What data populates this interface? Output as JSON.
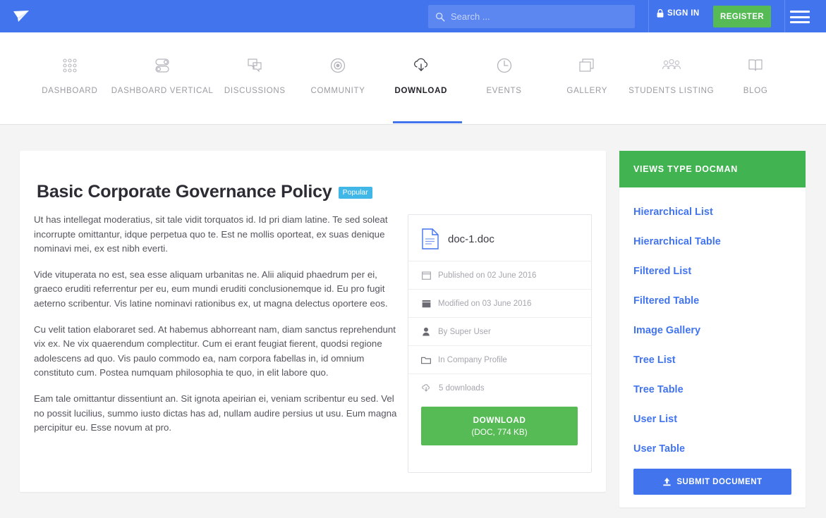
{
  "topbar": {
    "logo_icon": "paper-plane-icon",
    "search": {
      "placeholder": "Search ...",
      "value": "",
      "icon": "search-icon"
    },
    "signin_label": "SIGN IN",
    "signin_icon": "lock-icon",
    "register_label": "REGISTER",
    "menu_icon": "hamburger-menu-icon",
    "bg_color": "#4274ee",
    "register_color": "#56bb55"
  },
  "nav": {
    "items": [
      {
        "label": "DASHBOARD",
        "icon": "grid-dots-icon",
        "active": false
      },
      {
        "label": "DASHBOARD VERTICAL",
        "icon": "toggle-switches-icon",
        "active": false
      },
      {
        "label": "DISCUSSIONS",
        "icon": "chat-bubbles-icon",
        "active": false
      },
      {
        "label": "COMMUNITY",
        "icon": "circle-target-icon",
        "active": false
      },
      {
        "label": "DOWNLOAD",
        "icon": "cloud-download-icon",
        "active": true
      },
      {
        "label": "EVENTS",
        "icon": "clock-icon",
        "active": false
      },
      {
        "label": "GALLERY",
        "icon": "stacked-squares-icon",
        "active": false
      },
      {
        "label": "STUDENTS LISTING",
        "icon": "people-group-icon",
        "active": false
      },
      {
        "label": "BLOG",
        "icon": "open-book-icon",
        "active": false
      }
    ],
    "active_accent": "#4274ee"
  },
  "main": {
    "title": "Basic Corporate Governance Policy",
    "badge": "Popular",
    "badge_color": "#41b7e8",
    "paragraphs": [
      "Ut has intellegat moderatius, sit tale vidit torquatos id. Id pri diam latine. Te sed soleat incorrupte omittantur, idque perpetua quo te. Est ne mollis oporteat, ex suas denique nominavi mei, ex est nibh everti.",
      "Vide vituperata no est, sea esse aliquam urbanitas ne. Alii aliquid phaedrum per ei, graeco eruditi referrentur per eu, eum mundi eruditi conclusionemque id. Eu pro fugit aeterno scribentur. Vis latine nominavi rationibus ex, ut magna delectus oportere eos.",
      "Cu velit tation elaboraret sed. At habemus abhorreant nam, diam sanctus reprehendunt vix ex. Ne vix quaerendum complectitur. Cum ei erant feugiat fierent, quodsi regione adolescens ad quo. Vis paulo commodo ea, nam corpora fabellas in, id omnium constituto cum. Postea numquam philosophia te quo, in elit labore quo.",
      "Eam tale omittantur dissentiunt an. Sit ignota apeirian ei, veniam scribentur eu sed. Vel no possit lucilius, summo iusto dictas has ad, nullam audire persius ut usu. Eum magna percipitur eu. Esse novum at pro."
    ]
  },
  "doc_card": {
    "file_name": "doc-1.doc",
    "file_icon": "document-icon",
    "meta": [
      {
        "icon": "calendar-outline-icon",
        "text": "Published on 02 June 2016"
      },
      {
        "icon": "calendar-filled-icon",
        "text": "Modified on 03 June 2016"
      },
      {
        "icon": "user-icon",
        "text": "By Super User"
      },
      {
        "icon": "folder-icon",
        "text": "In Company Profile"
      },
      {
        "icon": "cloud-download-icon",
        "text": "5 downloads"
      }
    ],
    "download_label": "DOWNLOAD",
    "download_sub": "(DOC, 774 KB)",
    "download_color": "#56bb55"
  },
  "sidebar": {
    "header": "VIEWS TYPE DOCMAN",
    "header_color": "#41b451",
    "link_color": "#4274ee",
    "links": [
      {
        "label": "Hierarchical List"
      },
      {
        "label": "Hierarchical Table"
      },
      {
        "label": "Filtered List"
      },
      {
        "label": "Filtered Table"
      },
      {
        "label": "Image Gallery"
      },
      {
        "label": "Tree List"
      },
      {
        "label": "Tree Table"
      },
      {
        "label": "User List"
      },
      {
        "label": "User Table"
      }
    ],
    "submit_label": "SUBMIT DOCUMENT",
    "submit_icon": "upload-icon"
  }
}
